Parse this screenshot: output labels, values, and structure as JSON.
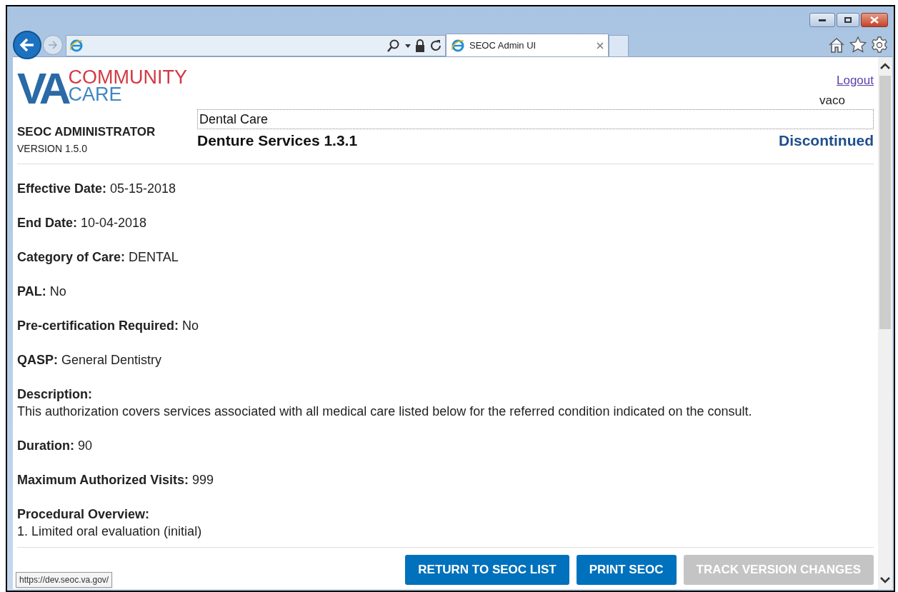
{
  "browser": {
    "tab_title": "SEOC Admin UI",
    "status_url": "https://dev.seoc.va.gov/"
  },
  "header": {
    "logo": {
      "mark": "VA",
      "line1": "COMMUNITY",
      "line2": "CARE"
    },
    "app_title": "SEOC ADMINISTRATOR",
    "version": "VERSION 1.5.0",
    "logout": "Logout",
    "user": "vaco",
    "category": "Dental Care",
    "seoc_name": "Denture Services 1.3.1",
    "status": "Discontinued"
  },
  "fields": [
    {
      "kind": "inline",
      "label": "Effective Date:",
      "value": "05-15-2018"
    },
    {
      "kind": "inline",
      "label": "End Date:",
      "value": "10-04-2018"
    },
    {
      "kind": "inline",
      "label": "Category of Care:",
      "value": "DENTAL"
    },
    {
      "kind": "inline",
      "label": "PAL:",
      "value": "No"
    },
    {
      "kind": "inline",
      "label": "Pre-certification Required:",
      "value": "No"
    },
    {
      "kind": "inline",
      "label": "QASP:",
      "value": "General Dentistry"
    },
    {
      "kind": "block",
      "label": "Description:",
      "value": "This authorization covers services associated with all medical care listed below for the referred condition indicated on the consult."
    },
    {
      "kind": "inline",
      "label": "Duration:",
      "value": "90"
    },
    {
      "kind": "inline",
      "label": "Maximum Authorized Visits:",
      "value": "999"
    },
    {
      "kind": "list",
      "label": "Procedural Overview:",
      "items": [
        "1. Limited oral evaluation (initial)"
      ]
    }
  ],
  "buttons": [
    {
      "label": "RETURN TO SEOC LIST",
      "disabled": false
    },
    {
      "label": "PRINT SEOC",
      "disabled": false
    },
    {
      "label": "TRACK VERSION CHANGES",
      "disabled": true
    }
  ]
}
